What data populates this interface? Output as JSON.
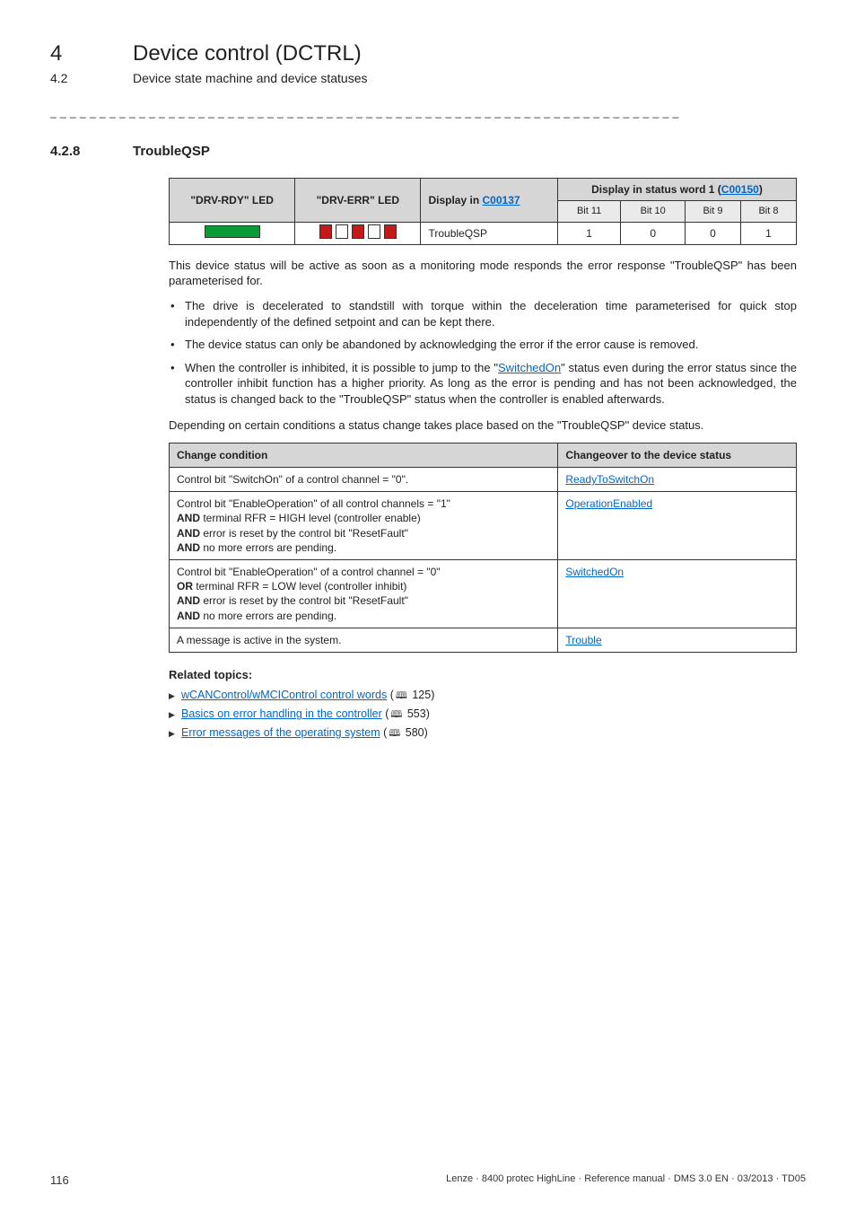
{
  "header": {
    "chapter_num": "4",
    "chapter_title": "Device control (DCTRL)",
    "sub_num": "4.2",
    "sub_title": "Device state machine and device statuses"
  },
  "separator": "_ _ _ _ _ _ _ _ _ _ _ _ _ _ _ _ _ _ _ _ _ _ _ _ _ _ _ _ _ _ _ _ _ _ _ _ _ _ _ _ _ _ _ _ _ _ _ _ _ _ _ _ _ _ _ _ _ _ _ _ _ _ _ _",
  "section": {
    "num": "4.2.8",
    "title": "TroubleQSP"
  },
  "table1": {
    "headers": {
      "rdy": "\"DRV-RDY\" LED",
      "err": "\"DRV-ERR\" LED",
      "disp_prefix": "Display in ",
      "disp_link": "C00137",
      "status_prefix": "Display in status word 1 (",
      "status_link": "C00150",
      "status_suffix": ")"
    },
    "bits": {
      "b11": "Bit 11",
      "b10": "Bit 10",
      "b9": "Bit 9",
      "b8": "Bit 8"
    },
    "row": {
      "disp": "TroubleQSP",
      "b11": "1",
      "b10": "0",
      "b9": "0",
      "b8": "1"
    }
  },
  "para1": "This device status will be active as soon as a monitoring mode responds the error response \"TroubleQSP\" has been parameterised for.",
  "bullets": [
    "The drive is decelerated to standstill with torque within the deceleration time parameterised for quick stop independently of the defined setpoint and can be kept there.",
    "The device status can only be abandoned by acknowledging the error if the error cause is removed."
  ],
  "bullet3": {
    "pre": "When the controller is inhibited, it is possible to jump to the \"",
    "link": "SwitchedOn",
    "post": "\" status even during the error status since the controller inhibit function has a higher priority. As long as the error is pending and has not been acknowledged, the status is changed back to the \"TroubleQSP\" status when the controller is enabled afterwards."
  },
  "para2": "Depending on certain conditions a status change takes place based on the \"TroubleQSP\" device status.",
  "table2": {
    "h1": "Change condition",
    "h2": "Changeover to the device status",
    "rows": [
      {
        "cond_html": "Control bit \"SwitchOn\" of a control channel = \"0\".",
        "link": "ReadyToSwitchOn"
      },
      {
        "cond_lines": [
          {
            "pre": "Control bit \"EnableOperation\" of all control channels = \"1\""
          },
          {
            "bold": "AND",
            "rest": " terminal RFR = HIGH level (controller enable)"
          },
          {
            "bold": "AND",
            "rest": " error is reset by the control bit \"ResetFault\""
          },
          {
            "bold": "AND",
            "rest": " no more errors are pending."
          }
        ],
        "link": "OperationEnabled"
      },
      {
        "cond_lines": [
          {
            "pre": "Control bit \"EnableOperation\" of a control channel = \"0\""
          },
          {
            "bold": "OR",
            "rest": " terminal RFR = LOW level (controller inhibit)"
          },
          {
            "bold": "AND",
            "rest": " error is reset by the control bit \"ResetFault\""
          },
          {
            "bold": "AND",
            "rest": " no more errors are pending."
          }
        ],
        "link": "SwitchedOn"
      },
      {
        "cond_html": "A message is active in the system.",
        "link": "Trouble"
      }
    ]
  },
  "related": {
    "heading": "Related topics:",
    "items": [
      {
        "text": "wCANControl/wMCIControl control words",
        "page": "125"
      },
      {
        "text": "Basics on error handling in the controller",
        "page": "553"
      },
      {
        "text": "Error messages of the operating system",
        "page": "580"
      }
    ]
  },
  "footer": {
    "page": "116",
    "doc": "Lenze · 8400 protec HighLine · Reference manual · DMS 3.0 EN · 03/2013 · TD05"
  }
}
